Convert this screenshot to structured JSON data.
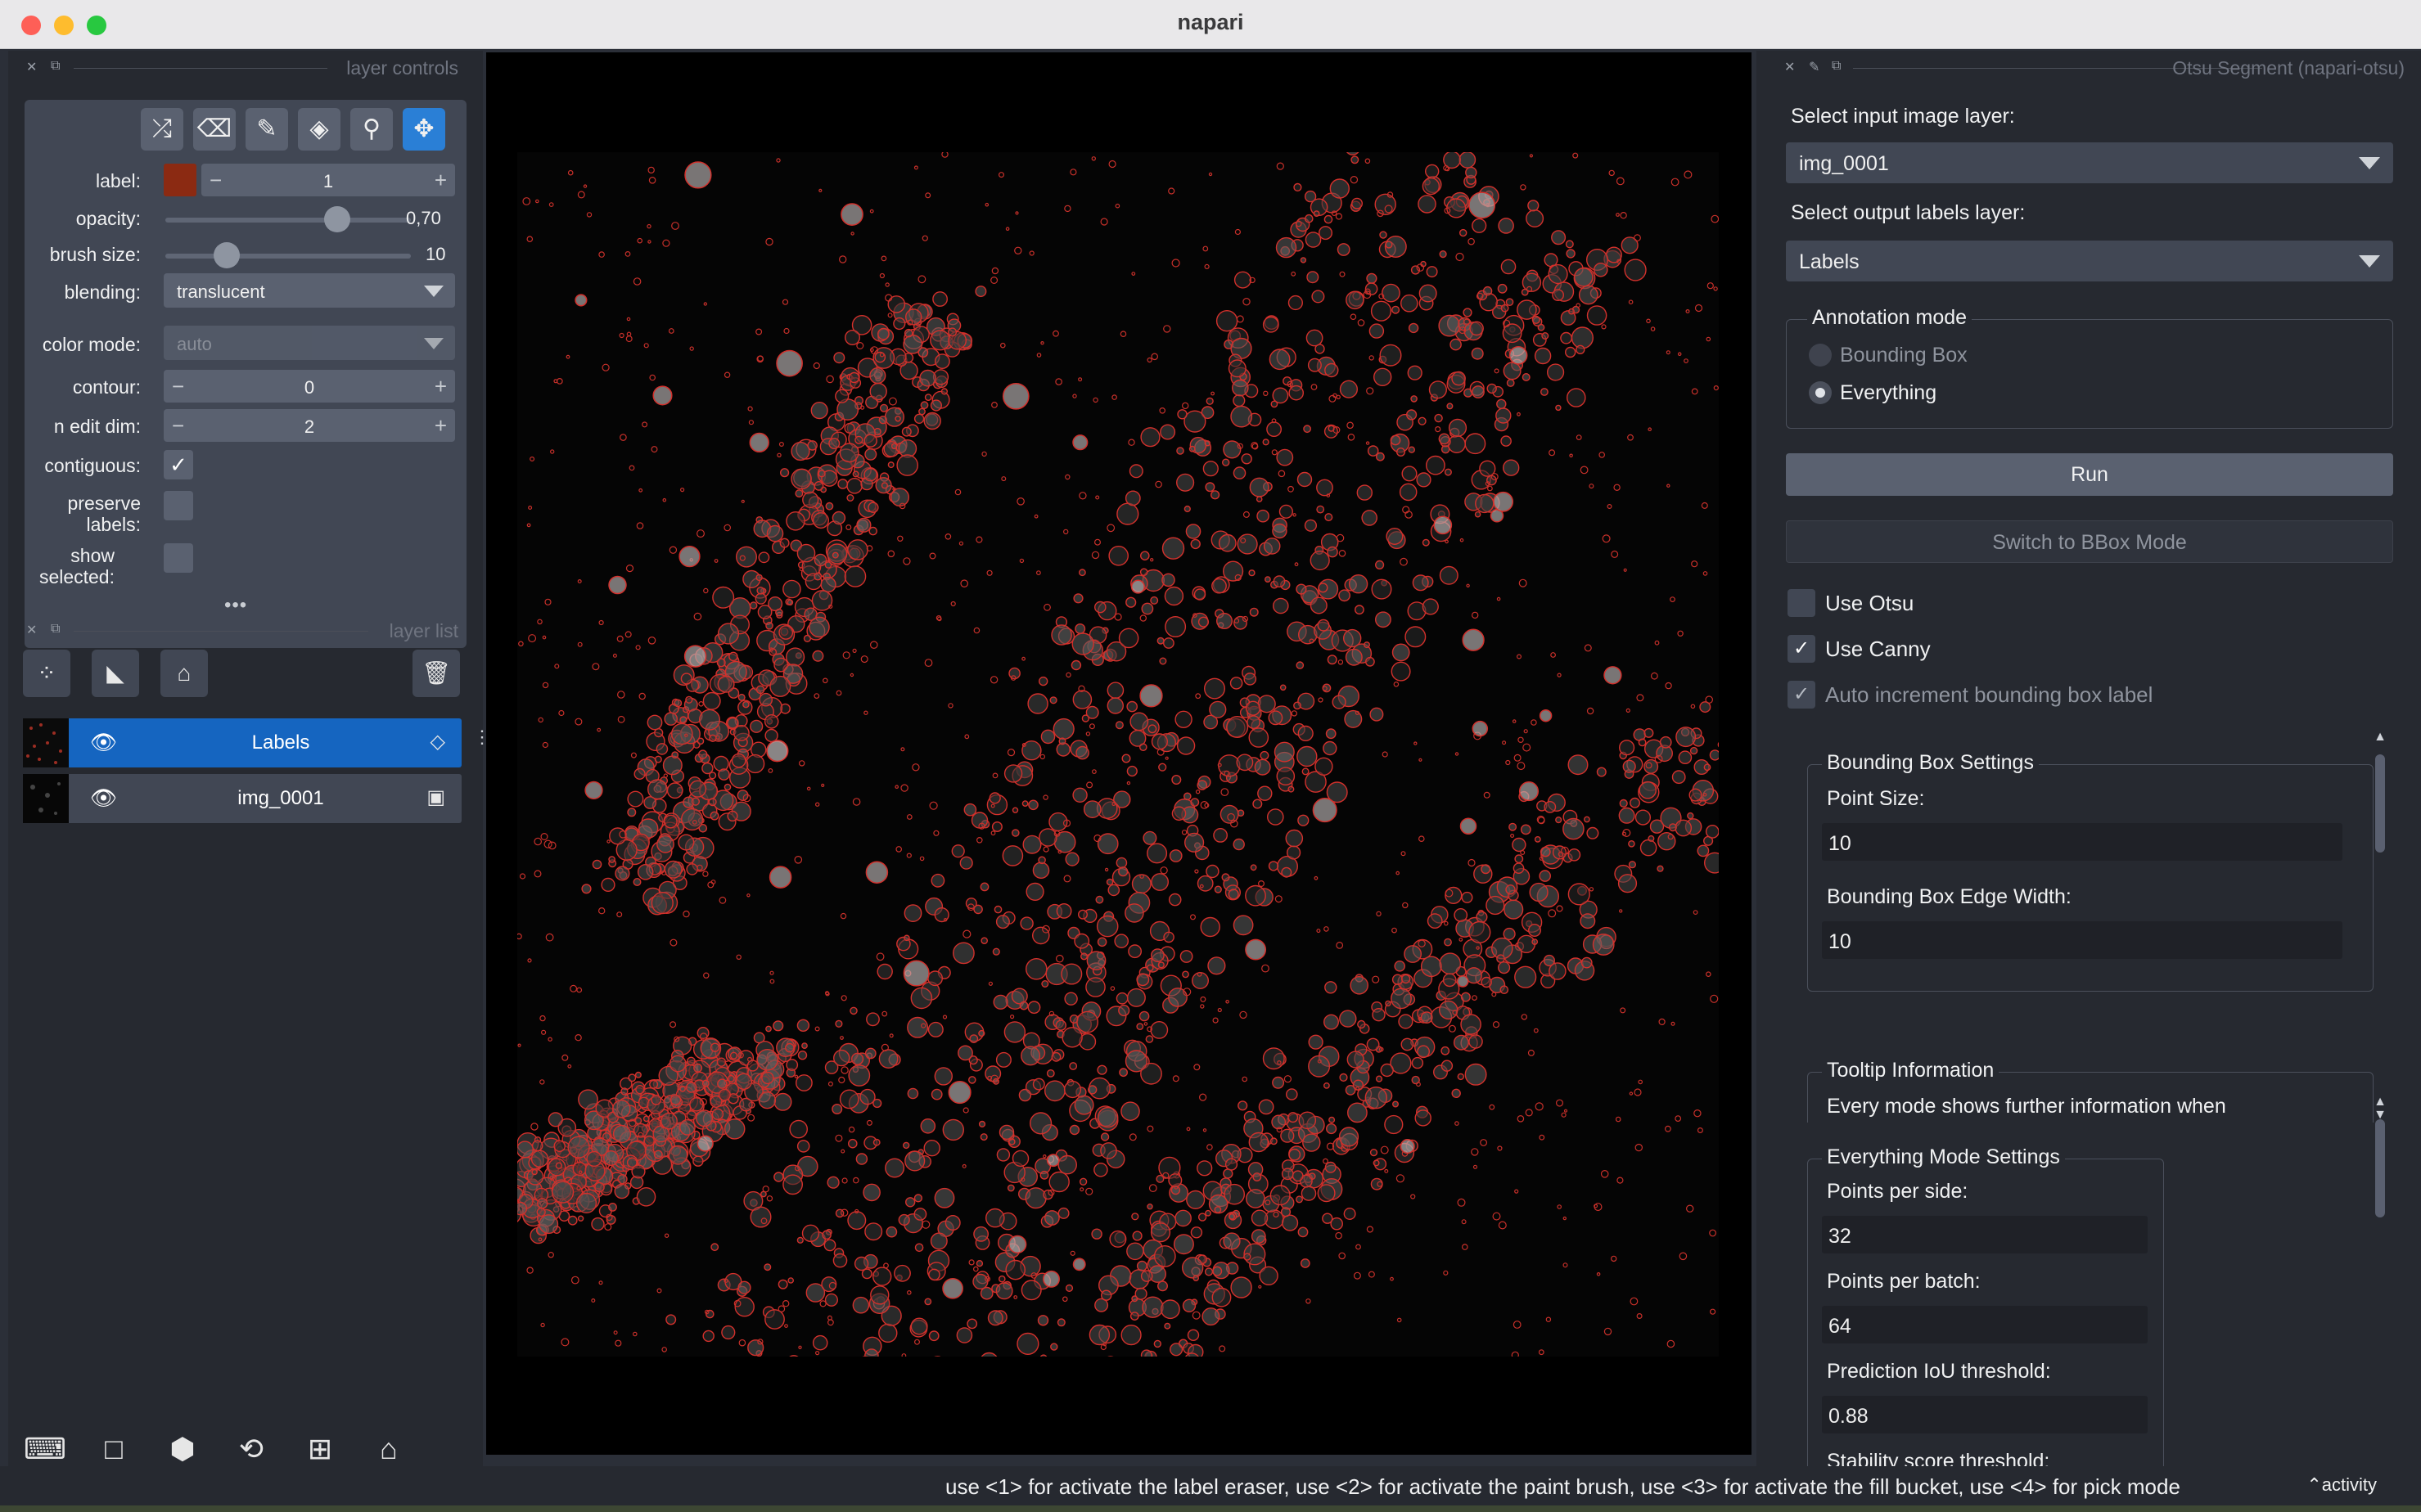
{
  "window": {
    "title": "napari"
  },
  "layer_controls": {
    "title": "layer controls",
    "label_label": "label:",
    "label_value": "1",
    "label_color": "#8b2a12",
    "opacity_label": "opacity:",
    "opacity_value": "0,70",
    "opacity_fraction": 0.7,
    "brush_label": "brush size:",
    "brush_value": "10",
    "brush_fraction": 0.25,
    "blending_label": "blending:",
    "blending_value": "translucent",
    "colormode_label": "color mode:",
    "colormode_value": "auto",
    "contour_label": "contour:",
    "contour_value": "0",
    "nedit_label": "n edit dim:",
    "nedit_value": "2",
    "contiguous_label": "contiguous:",
    "contiguous_checked": true,
    "preserve_label": "preserve labels:",
    "preserve_checked": false,
    "show_selected_label": "show selected:",
    "show_selected_checked": false,
    "tools": [
      "shuffle-icon",
      "eraser-icon",
      "brush-icon",
      "fill-bucket-icon",
      "picker-icon",
      "move-icon"
    ],
    "active_tool": "move-icon"
  },
  "layer_list": {
    "title": "layer list",
    "layers": [
      {
        "name": "Labels",
        "type_icon": "label-tag-icon",
        "visible": true,
        "selected": true
      },
      {
        "name": "img_0001",
        "type_icon": "image-icon",
        "visible": true,
        "selected": false
      }
    ]
  },
  "plugin": {
    "title": "Otsu Segment (napari-otsu)",
    "input_label": "Select input image layer:",
    "input_value": "img_0001",
    "output_label": "Select output labels layer:",
    "output_value": "Labels",
    "annotation_title": "Annotation mode",
    "mode_bbox": "Bounding Box",
    "mode_everything": "Everything",
    "selected_mode": "Everything",
    "run_label": "Run",
    "switch_label": "Switch to BBox Mode",
    "use_otsu_label": "Use Otsu",
    "use_otsu_checked": false,
    "use_canny_label": "Use Canny",
    "use_canny_checked": true,
    "auto_inc_label": "Auto increment bounding box label",
    "auto_inc_checked": true,
    "bbox_settings_title": "Bounding Box Settings",
    "point_size_label": "Point Size:",
    "point_size_value": "10",
    "edge_width_label": "Bounding Box Edge Width:",
    "edge_width_value": "10",
    "tooltip_title": "Tooltip Information",
    "tooltip_text": "Every mode shows further information when",
    "everything_title": "Everything Mode Settings",
    "pps_label": "Points per side:",
    "pps_value": "32",
    "ppb_label": "Points per batch:",
    "ppb_value": "64",
    "iou_label": "Prediction IoU threshold:",
    "iou_value": "0.88",
    "stability_label": "Stability score threshold:"
  },
  "status": {
    "text": "use <1> for activate the label eraser, use <2> for activate the paint brush, use <3> for activate the fill bucket, use <4> for pick mode",
    "activity": "activity"
  },
  "colors": {
    "accent": "#1565c0",
    "active_tool": "#2a7fd6",
    "contour": "#d3302b"
  }
}
